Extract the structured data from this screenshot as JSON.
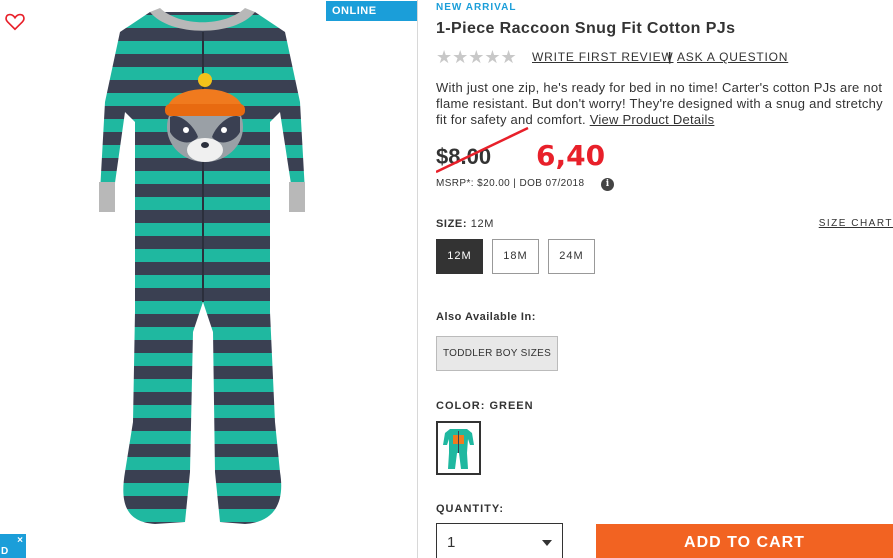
{
  "badges": {
    "online_only": "ONLINE ONLY",
    "new_arrival": "NEW ARRIVAL"
  },
  "product": {
    "title": "1-Piece Raccoon Snug Fit Cotton PJs",
    "rating_stars": "★★★★★",
    "rating_value": 0,
    "write_review": "WRITE FIRST REVIEW",
    "separator": "|",
    "ask_question": "ASK A QUESTION",
    "description": "With just one zip, he's ready for bed in no time! Carter's cotton PJs are not flame resistant. But don't worry! They're designed with a snug and stretchy fit for safety and comfort.",
    "details_link": "View Product Details"
  },
  "price": {
    "original": "$8.00",
    "annotated": "6,40",
    "msrp": "MSRP*: $20.00 | DOB 07/2018",
    "info_icon": "i"
  },
  "size": {
    "label": "SIZE:",
    "selected": "12M",
    "chart_link": "SIZE CHART",
    "options": [
      "12M",
      "18M",
      "24M"
    ]
  },
  "also_available": {
    "label": "Also Available In:",
    "option": "TODDLER BOY SIZES"
  },
  "color": {
    "label": "COLOR:",
    "selected": "GREEN"
  },
  "quantity": {
    "label": "QUANTITY:",
    "value": "1"
  },
  "cart": {
    "add_label": "ADD TO CART"
  },
  "chat": {
    "close": "×",
    "letter": "D"
  },
  "colors": {
    "accent_blue": "#1b9ed9",
    "cta_orange": "#f26322",
    "price_red": "#e8202a",
    "stripe_teal": "#1fb8a0",
    "stripe_navy": "#3a4052"
  }
}
